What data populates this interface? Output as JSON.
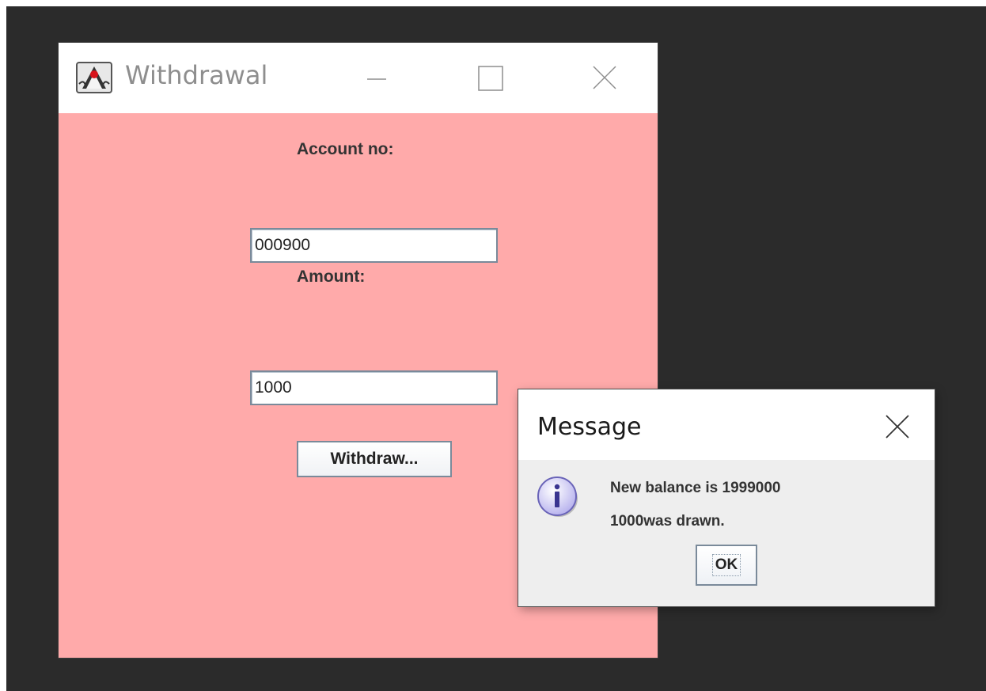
{
  "main_window": {
    "title": "Withdrawal",
    "icon": "java-duke-icon",
    "account_label": "Account no:",
    "account_value": "000900",
    "amount_label": "Amount:",
    "amount_value": "1000",
    "withdraw_button_label": "Withdraw...",
    "background_color": "#ffaaaa"
  },
  "dialog": {
    "title": "Message",
    "icon": "info-icon",
    "message_line_1": "New balance is 1999000",
    "message_line_2": "1000was drawn.",
    "ok_label": "OK"
  }
}
